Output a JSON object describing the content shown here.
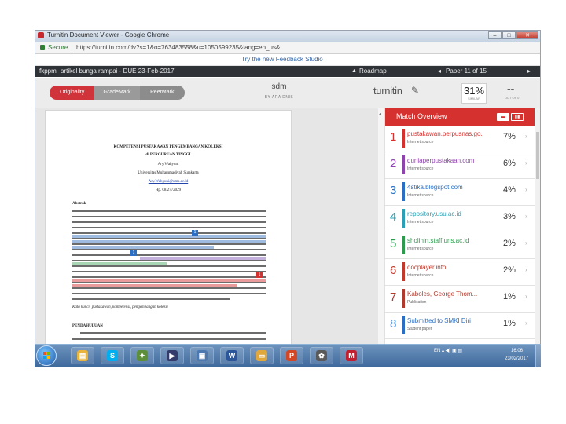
{
  "window": {
    "title": "Turnitin Document Viewer - Google Chrome",
    "controls": {
      "minimize": "–",
      "maximize": "□",
      "close": "✕"
    }
  },
  "address": {
    "secure_label": "Secure",
    "url": "https://turnitin.com/dv?s=1&o=763483558&u=1050599235&lang=en_us&"
  },
  "feedback_banner": "Try the new Feedback Studio",
  "header": {
    "user": "fkppm",
    "document": "artikel bunga rampai - DUE 23-Feb-2017",
    "roadmap": "Roadmap",
    "pager": "Paper 11 of 15",
    "prev": "◂",
    "next": "▸"
  },
  "tabs": [
    {
      "label": "Originality"
    },
    {
      "label": "GradeMark"
    },
    {
      "label": "PeerMark"
    }
  ],
  "doc_title": "sdm",
  "doc_author": "BY ARA DNIS",
  "logo": {
    "text": "turnitin",
    "icon": "✎"
  },
  "similarity": {
    "value": "31%",
    "label": "SIMILAR"
  },
  "grademark": {
    "value": "--",
    "label": "OUT OF 0"
  },
  "paper": {
    "title_line1": "KOMPETENSI PUSTAKAWAN PENGEMBANGAN KOLEKSI",
    "title_line2": "di PERGURUAN TINGGI",
    "author": "Ary Wahyuni",
    "affiliation": "Universitas Muhammadiyah Surakarta",
    "email": "Ary.Wahyuni@ums.ac.id",
    "phone": "Hp. 08.2772029",
    "abstract_heading": "Abstrak",
    "keywords": "Kata kunci: pustakawan, kompetensi, pengembangan koleksi",
    "section_heading": "PENDAHULUAN",
    "markers": [
      "1",
      "1",
      "1",
      "1"
    ]
  },
  "match_overview": {
    "title": "Match Overview",
    "icons": {
      "list": "▬",
      "chart": "▮▮"
    },
    "sources": [
      {
        "num": "1",
        "name": "pustakawan.perpusnas.go.id",
        "type": "Internet source",
        "pct": "7%",
        "color": "#d5312e"
      },
      {
        "num": "2",
        "name": "duniaperpustakaan.com",
        "type": "Internet source",
        "pct": "6%",
        "color": "#8e44ad"
      },
      {
        "num": "3",
        "name": "4stika.blogspot.com",
        "type": "Internet source",
        "pct": "4%",
        "color": "#2b6fc4"
      },
      {
        "num": "4",
        "name": "repository.usu.ac.id",
        "type": "Internet source",
        "pct": "3%",
        "color": "#2a9fb5"
      },
      {
        "num": "5",
        "name": "sholihin.staff.uns.ac.id",
        "type": "Internet source",
        "pct": "2%",
        "color": "#2e9a4e"
      },
      {
        "num": "6",
        "name": "docplayer.info",
        "type": "Internet source",
        "pct": "2%",
        "color": "#c0392b"
      },
      {
        "num": "7",
        "name": "Kaboles, George Thom...",
        "type": "Publication",
        "pct": "1%",
        "color": "#b03a2e"
      },
      {
        "num": "8",
        "name": "Submitted to SMKI Diri",
        "type": "Student paper",
        "pct": "1%",
        "color": "#2b6fc4"
      }
    ]
  },
  "taskbar": {
    "apps": [
      {
        "name": "folder",
        "glyph": "▤",
        "color": "#e8b43c"
      },
      {
        "name": "skype",
        "glyph": "S",
        "color": "#00aff0"
      },
      {
        "name": "network",
        "glyph": "✦",
        "color": "#5d8f3a"
      },
      {
        "name": "media",
        "glyph": "▶",
        "color": "#333c6b"
      },
      {
        "name": "photo",
        "glyph": "▣",
        "color": "#4c79b0"
      },
      {
        "name": "word",
        "glyph": "W",
        "color": "#2b579a"
      },
      {
        "name": "explorer",
        "glyph": "▭",
        "color": "#e0a83a"
      },
      {
        "name": "powerpoint",
        "glyph": "P",
        "color": "#d24726"
      },
      {
        "name": "paw",
        "glyph": "✿",
        "color": "#5a5a5a"
      },
      {
        "name": "mendeley",
        "glyph": "M",
        "color": "#c02030"
      }
    ],
    "tray": "EN  ▴  ◀)  ▣  ▤",
    "time": "16:06",
    "date": "23/02/2017"
  }
}
